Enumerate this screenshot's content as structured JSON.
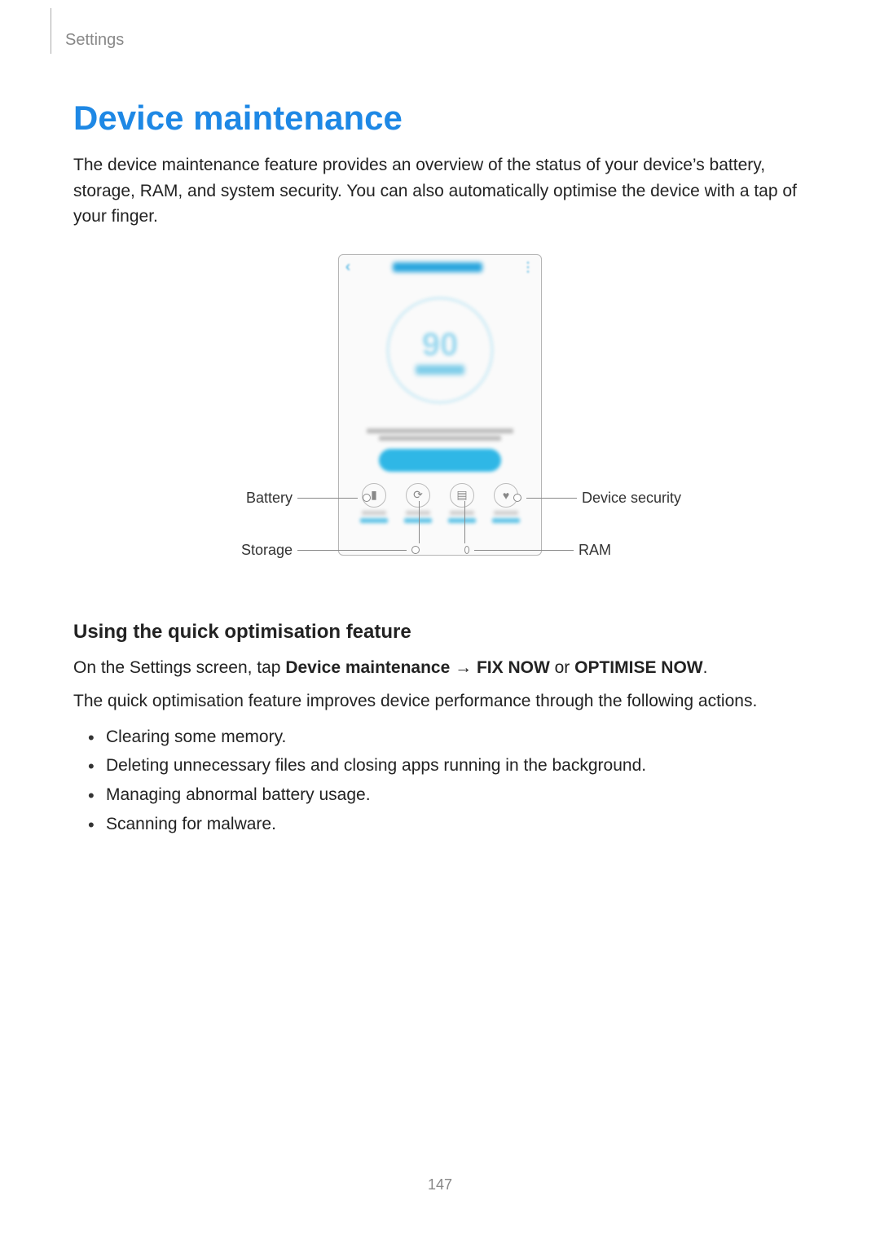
{
  "breadcrumb": "Settings",
  "title": "Device maintenance",
  "intro": "The device maintenance feature provides an overview of the status of your device’s battery, storage, RAM, and system security. You can also automatically optimise the device with a tap of your finger.",
  "callouts": {
    "battery": "Battery",
    "storage": "Storage",
    "device_security": "Device security",
    "ram": "RAM"
  },
  "subhead": "Using the quick optimisation feature",
  "instruction": {
    "prefix": "On the Settings screen, tap ",
    "b1": "Device maintenance",
    "arrow": " → ",
    "b2": "FIX NOW",
    "or": " or ",
    "b3": "OPTIMISE NOW",
    "suffix": "."
  },
  "followup": "The quick optimisation feature improves device performance through the following actions.",
  "bullets": [
    "Clearing some memory.",
    "Deleting unnecessary files and closing apps running in the background.",
    "Managing abnormal battery usage.",
    "Scanning for malware."
  ],
  "page_number": "147"
}
